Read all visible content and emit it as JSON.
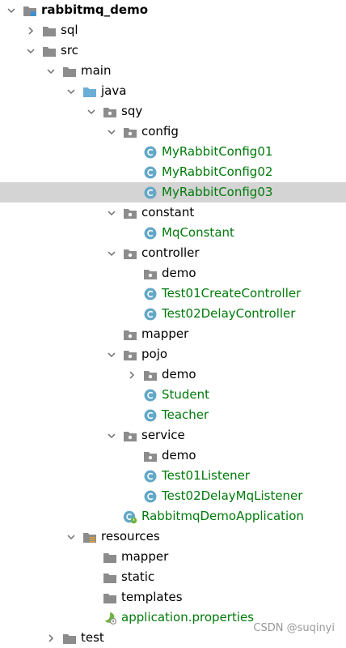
{
  "tree": {
    "root": {
      "label": "rabbitmq_demo",
      "icon": "module-folder-icon"
    },
    "sql": {
      "label": "sql",
      "icon": "folder-icon"
    },
    "src": {
      "label": "src",
      "icon": "folder-icon"
    },
    "main": {
      "label": "main",
      "icon": "folder-icon"
    },
    "java": {
      "label": "java",
      "icon": "source-folder-icon"
    },
    "sqy": {
      "label": "sqy",
      "icon": "package-icon"
    },
    "config": {
      "label": "config",
      "icon": "package-icon"
    },
    "myRabbitConfig01": {
      "label": "MyRabbitConfig01",
      "icon": "class-icon"
    },
    "myRabbitConfig02": {
      "label": "MyRabbitConfig02",
      "icon": "class-icon"
    },
    "myRabbitConfig03": {
      "label": "MyRabbitConfig03",
      "icon": "class-icon",
      "selected": true
    },
    "constant": {
      "label": "constant",
      "icon": "package-icon"
    },
    "mqConstant": {
      "label": "MqConstant",
      "icon": "class-icon"
    },
    "controller": {
      "label": "controller",
      "icon": "package-icon"
    },
    "controllerDemo": {
      "label": "demo",
      "icon": "package-icon"
    },
    "test01CreateController": {
      "label": "Test01CreateController",
      "icon": "class-icon"
    },
    "test02DelayController": {
      "label": "Test02DelayController",
      "icon": "class-icon"
    },
    "mapper": {
      "label": "mapper",
      "icon": "package-icon"
    },
    "pojo": {
      "label": "pojo",
      "icon": "package-icon"
    },
    "pojoDemo": {
      "label": "demo",
      "icon": "package-icon"
    },
    "student": {
      "label": "Student",
      "icon": "class-icon"
    },
    "teacher": {
      "label": "Teacher",
      "icon": "class-icon"
    },
    "service": {
      "label": "service",
      "icon": "package-icon"
    },
    "serviceDemo": {
      "label": "demo",
      "icon": "package-icon"
    },
    "test01Listener": {
      "label": "Test01Listener",
      "icon": "class-icon"
    },
    "test02DelayMqListener": {
      "label": "Test02DelayMqListener",
      "icon": "class-icon"
    },
    "rabbitmqDemoApplication": {
      "label": "RabbitmqDemoApplication",
      "icon": "spring-boot-class-icon"
    },
    "resources": {
      "label": "resources",
      "icon": "resources-folder-icon"
    },
    "resMapper": {
      "label": "mapper",
      "icon": "folder-icon"
    },
    "static": {
      "label": "static",
      "icon": "folder-icon"
    },
    "templates": {
      "label": "templates",
      "icon": "folder-icon"
    },
    "applicationProperties": {
      "label": "application.properties",
      "icon": "spring-properties-icon"
    },
    "test": {
      "label": "test",
      "icon": "folder-icon"
    }
  },
  "watermark": "CSDN @suqinyi",
  "colors": {
    "selection": "#d4d4d4",
    "class_text": "#007a0a",
    "class_icon": "#63a8c8",
    "folder": "#8c8c8c",
    "source_folder": "#6aaed6"
  }
}
